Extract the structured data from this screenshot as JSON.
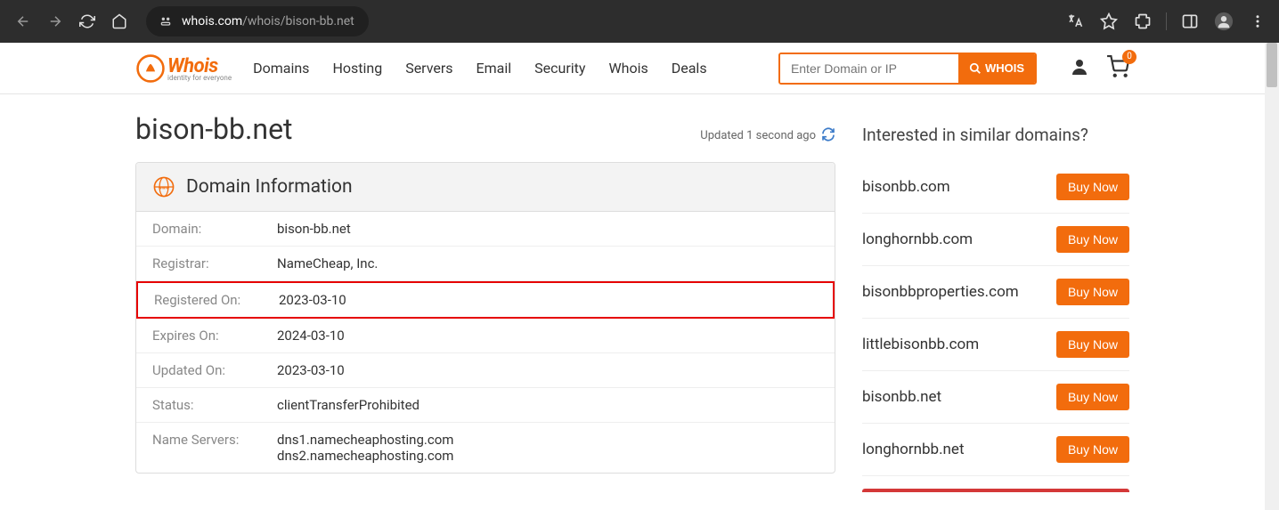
{
  "browser": {
    "url_domain": "whois.com",
    "url_path": "/whois/bison-bb.net"
  },
  "header": {
    "logo_text": "Whois",
    "logo_tagline": "identity for everyone",
    "nav": [
      "Domains",
      "Hosting",
      "Servers",
      "Email",
      "Security",
      "Whois",
      "Deals"
    ],
    "search_placeholder": "Enter Domain or IP",
    "search_btn": "WHOIS",
    "cart_count": "0"
  },
  "main": {
    "domain_title": "bison-bb.net",
    "updated_text": "Updated 1 second ago",
    "panel_title": "Domain Information",
    "rows": [
      {
        "label": "Domain:",
        "value": "bison-bb.net"
      },
      {
        "label": "Registrar:",
        "value": "NameCheap, Inc."
      },
      {
        "label": "Registered On:",
        "value": "2023-03-10"
      },
      {
        "label": "Expires On:",
        "value": "2024-03-10"
      },
      {
        "label": "Updated On:",
        "value": "2023-03-10"
      },
      {
        "label": "Status:",
        "value": "clientTransferProhibited"
      },
      {
        "label": "Name Servers:",
        "value": "dns1.namecheaphosting.com\ndns2.namecheaphosting.com"
      }
    ]
  },
  "sidebar": {
    "title": "Interested in similar domains?",
    "buy_label": "Buy Now",
    "domains": [
      "bisonbb.com",
      "longhornbb.com",
      "bisonbbproperties.com",
      "littlebisonbb.com",
      "bisonbb.net",
      "longhornbb.net"
    ]
  }
}
